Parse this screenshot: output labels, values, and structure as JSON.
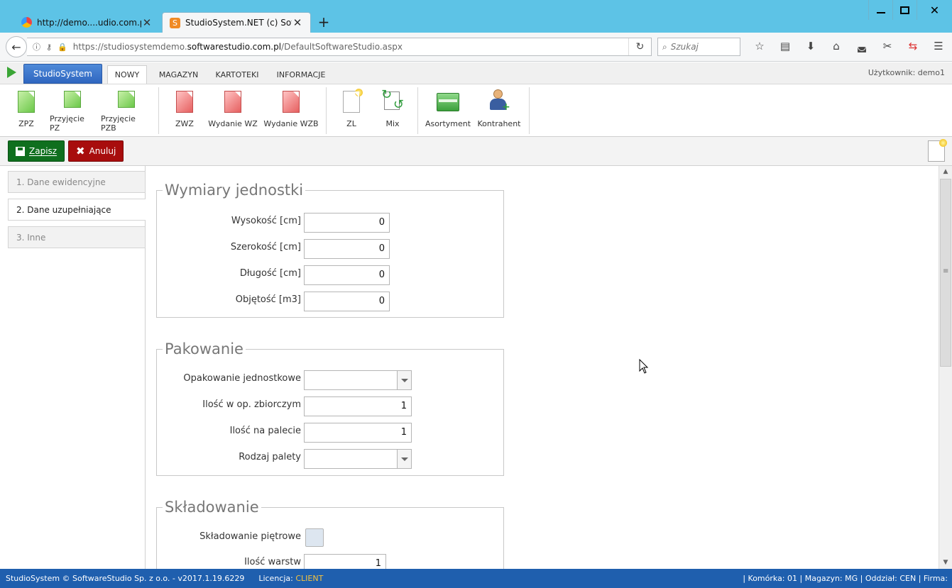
{
  "browser": {
    "tabs": [
      {
        "title": "http://demo....udio.com.pl/",
        "active": false
      },
      {
        "title": "StudioSystem.NET (c) Soft...",
        "active": true
      }
    ],
    "new_tab": "+",
    "url_prefix": "https://studiosystemdemo.",
    "url_domain": "softwarestudio.com.pl",
    "url_path": "/DefaultSoftwareStudio.aspx",
    "search_placeholder": "Szukaj",
    "colors": {
      "tabbar": "#5dc3e6"
    }
  },
  "app": {
    "logo_label": "StudioSystem",
    "menu": [
      "NOWY",
      "MAGAZYN",
      "KARTOTEKI",
      "INFORMACJE"
    ],
    "active_menu": "NOWY",
    "user_label": "Użytkownik: demo1",
    "ribbon": [
      {
        "label": "ZPZ",
        "icon": "green-document-icon"
      },
      {
        "label": "Przyjęcie PZ",
        "icon": "green-document-icon"
      },
      {
        "label": "Przyjęcie PZB",
        "icon": "green-document-icon"
      },
      {
        "label": "ZWZ",
        "icon": "red-document-icon"
      },
      {
        "label": "Wydanie WZ",
        "icon": "red-document-icon"
      },
      {
        "label": "Wydanie WZB",
        "icon": "red-document-icon"
      },
      {
        "label": "ZL",
        "icon": "new-document-icon"
      },
      {
        "label": "Mix",
        "icon": "mix-icon"
      },
      {
        "label": "Asortyment",
        "icon": "box-icon"
      },
      {
        "label": "Kontrahent",
        "icon": "add-person-icon"
      }
    ],
    "actions": {
      "save": "Zapisz",
      "cancel": "Anuluj"
    },
    "colors": {
      "save": "#0f6f1e",
      "cancel": "#a80d0d",
      "brand": "#2f66c0",
      "statusbar": "#1f5fae"
    }
  },
  "sidetabs": [
    "1. Dane ewidencyjne",
    "2. Dane uzupełniające",
    "3. Inne"
  ],
  "active_sidetab": "2. Dane uzupełniające",
  "groups": {
    "wymiary": {
      "title": "Wymiary jednostki",
      "fields": [
        {
          "label": "Wysokość [cm]",
          "value": "0"
        },
        {
          "label": "Szerokość [cm]",
          "value": "0"
        },
        {
          "label": "Długość [cm]",
          "value": "0"
        },
        {
          "label": "Objętość [m3]",
          "value": "0"
        }
      ]
    },
    "pakowanie": {
      "title": "Pakowanie",
      "fields": [
        {
          "label": "Opakowanie jednostkowe",
          "value": ""
        },
        {
          "label": "Ilość w op. zbiorczym",
          "value": "1"
        },
        {
          "label": "Ilość na palecie",
          "value": "1"
        },
        {
          "label": "Rodzaj palety",
          "value": ""
        }
      ]
    },
    "skladowanie": {
      "title": "Składowanie",
      "fields": [
        {
          "label": "Składowanie piętrowe",
          "value": ""
        },
        {
          "label": "Ilość warstw",
          "value": "1"
        }
      ]
    }
  },
  "status": {
    "left": "StudioSystem © SoftwareStudio Sp. z o.o. - v2017.1.19.6229",
    "license_label": "Licencja:",
    "license_value": "CLIENT",
    "right": "| Komórka: 01 | Magazyn: MG | Oddział: CEN | Firma:"
  }
}
